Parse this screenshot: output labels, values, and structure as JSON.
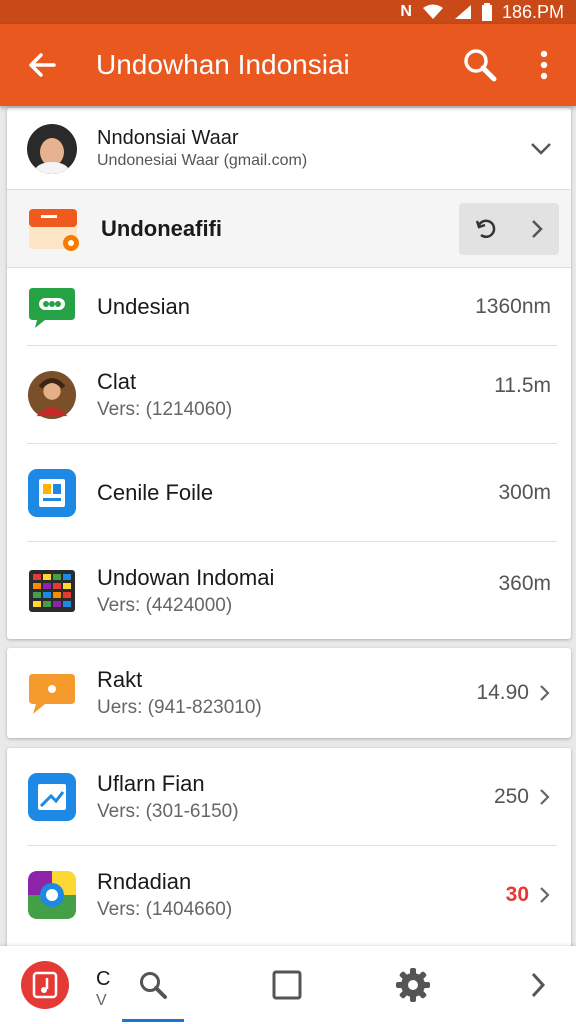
{
  "status_bar": {
    "time": "186.PM",
    "icons": [
      "n-icon",
      "wifi-icon",
      "signal-icon",
      "battery-icon"
    ]
  },
  "app_bar": {
    "title": "Undowhan Indonsiai",
    "icons": [
      "back-arrow-icon",
      "search-icon",
      "overflow-menu-icon"
    ],
    "color": "#e8581f"
  },
  "account": {
    "name": "Nndonsiai Waar",
    "subtitle": "Undonesiai Waar (gmail.com)"
  },
  "featured": {
    "label": "Undoneafifi"
  },
  "list_group_1": [
    {
      "name": "Undesian",
      "version": "",
      "size": "1360nm",
      "icon": "chat-bubble-icon"
    },
    {
      "name": "Clat",
      "version": "Vers: (1214060)",
      "size": "11.5m",
      "icon": "photo-avatar-icon"
    },
    {
      "name": "Cenile Foile",
      "version": "",
      "size": "300m",
      "icon": "file-manager-icon"
    },
    {
      "name": "Undowan Indomai",
      "version": "Vers: (4424000)",
      "size": "360m",
      "icon": "game-grid-icon"
    }
  ],
  "list_group_2": [
    {
      "name": "Rakt",
      "version": "Uers: (941-823010)",
      "size": "14.90",
      "icon": "message-icon"
    }
  ],
  "list_group_3": [
    {
      "name": "Uflarn Fian",
      "version": "Vers: (301-6150)",
      "size": "250",
      "size_color": "#555555",
      "icon": "gallery-icon"
    },
    {
      "name": "Rndadian",
      "version": "Vers: (1404660)",
      "size": "30",
      "size_color": "#e53935",
      "icon": "camera-lens-icon"
    }
  ],
  "bottom_bar": {
    "partial_label": "C",
    "partial_sub": "V",
    "icons": [
      "music-icon",
      "search-icon",
      "square-icon",
      "settings-gear-icon",
      "chevron-right-icon"
    ]
  }
}
